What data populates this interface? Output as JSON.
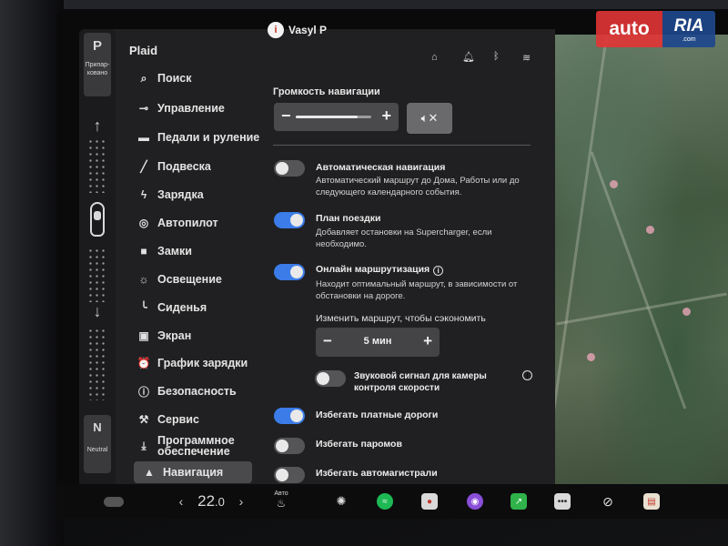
{
  "sidebar": {
    "brand": "Plaid",
    "gear_top": {
      "letter": "P",
      "label": "Припар-ковано"
    },
    "gear_bottom": {
      "letter": "N",
      "label": "Neutral"
    },
    "items": [
      {
        "icon": "search-icon",
        "label": "Поиск"
      },
      {
        "icon": "toggle-icon",
        "label": "Управление"
      },
      {
        "icon": "car-icon",
        "label": "Педали и руление"
      },
      {
        "icon": "suspension-icon",
        "label": "Подвеска"
      },
      {
        "icon": "lightning-icon",
        "label": "Зарядка"
      },
      {
        "icon": "steering-wheel-icon",
        "label": "Автопилот"
      },
      {
        "icon": "lock-icon",
        "label": "Замки"
      },
      {
        "icon": "sun-icon",
        "label": "Освещение"
      },
      {
        "icon": "seat-icon",
        "label": "Сиденья"
      },
      {
        "icon": "screen-icon",
        "label": "Экран"
      },
      {
        "icon": "alarm-clock-icon",
        "label": "График зарядки"
      },
      {
        "icon": "shield-icon",
        "label": "Безопасность"
      },
      {
        "icon": "wrench-icon",
        "label": "Сервис"
      },
      {
        "icon": "download-icon",
        "label": "Программное обеспечение"
      },
      {
        "icon": "navigation-icon",
        "label": "Навигация"
      }
    ]
  },
  "header": {
    "user_name": "Vasyl P",
    "avatar_letter": "i",
    "icons": [
      "home-icon",
      "bell-icon",
      "bluetooth-icon",
      "wifi-icon"
    ]
  },
  "navigation_settings": {
    "volume_title": "Громкость навигации",
    "volume_level": 0.82,
    "options": [
      {
        "title": "Автоматическая навигация",
        "desc": "Автоматический маршрут до Дома, Работы или до следующего календарного события.",
        "on": false
      },
      {
        "title": "План поездки",
        "desc": "Добавляет остановки на Supercharger, если необходимо.",
        "on": true
      },
      {
        "title": "Онлайн маршрутизация",
        "desc": "Находит оптимальный маршрут, в зависимости от обстановки на дороге.",
        "on": true
      }
    ],
    "reroute_label": "Изменить маршрут, чтобы сэкономить",
    "reroute_value": "5 мин",
    "speed_camera": {
      "title": "Звуковой сигнал для камеры контроля скорости",
      "on": false
    },
    "avoid": [
      {
        "title": "Избегать платные дороги",
        "on": true
      },
      {
        "title": "Избегать паромов",
        "on": false
      },
      {
        "title": "Избегать автомагистрали",
        "on": false
      }
    ]
  },
  "taskbar": {
    "temperature": "22",
    "temperature_decimal": ".0",
    "seat_heat_label": "Авто",
    "apps": [
      "car-icon",
      "fan-icon",
      "spotify-icon",
      "camera-icon",
      "media-icon",
      "charts-icon",
      "more-icon",
      "no-location-icon",
      "calendar-icon"
    ]
  },
  "watermark": {
    "left": "auto",
    "right": "RIA",
    "sub": ".com"
  }
}
